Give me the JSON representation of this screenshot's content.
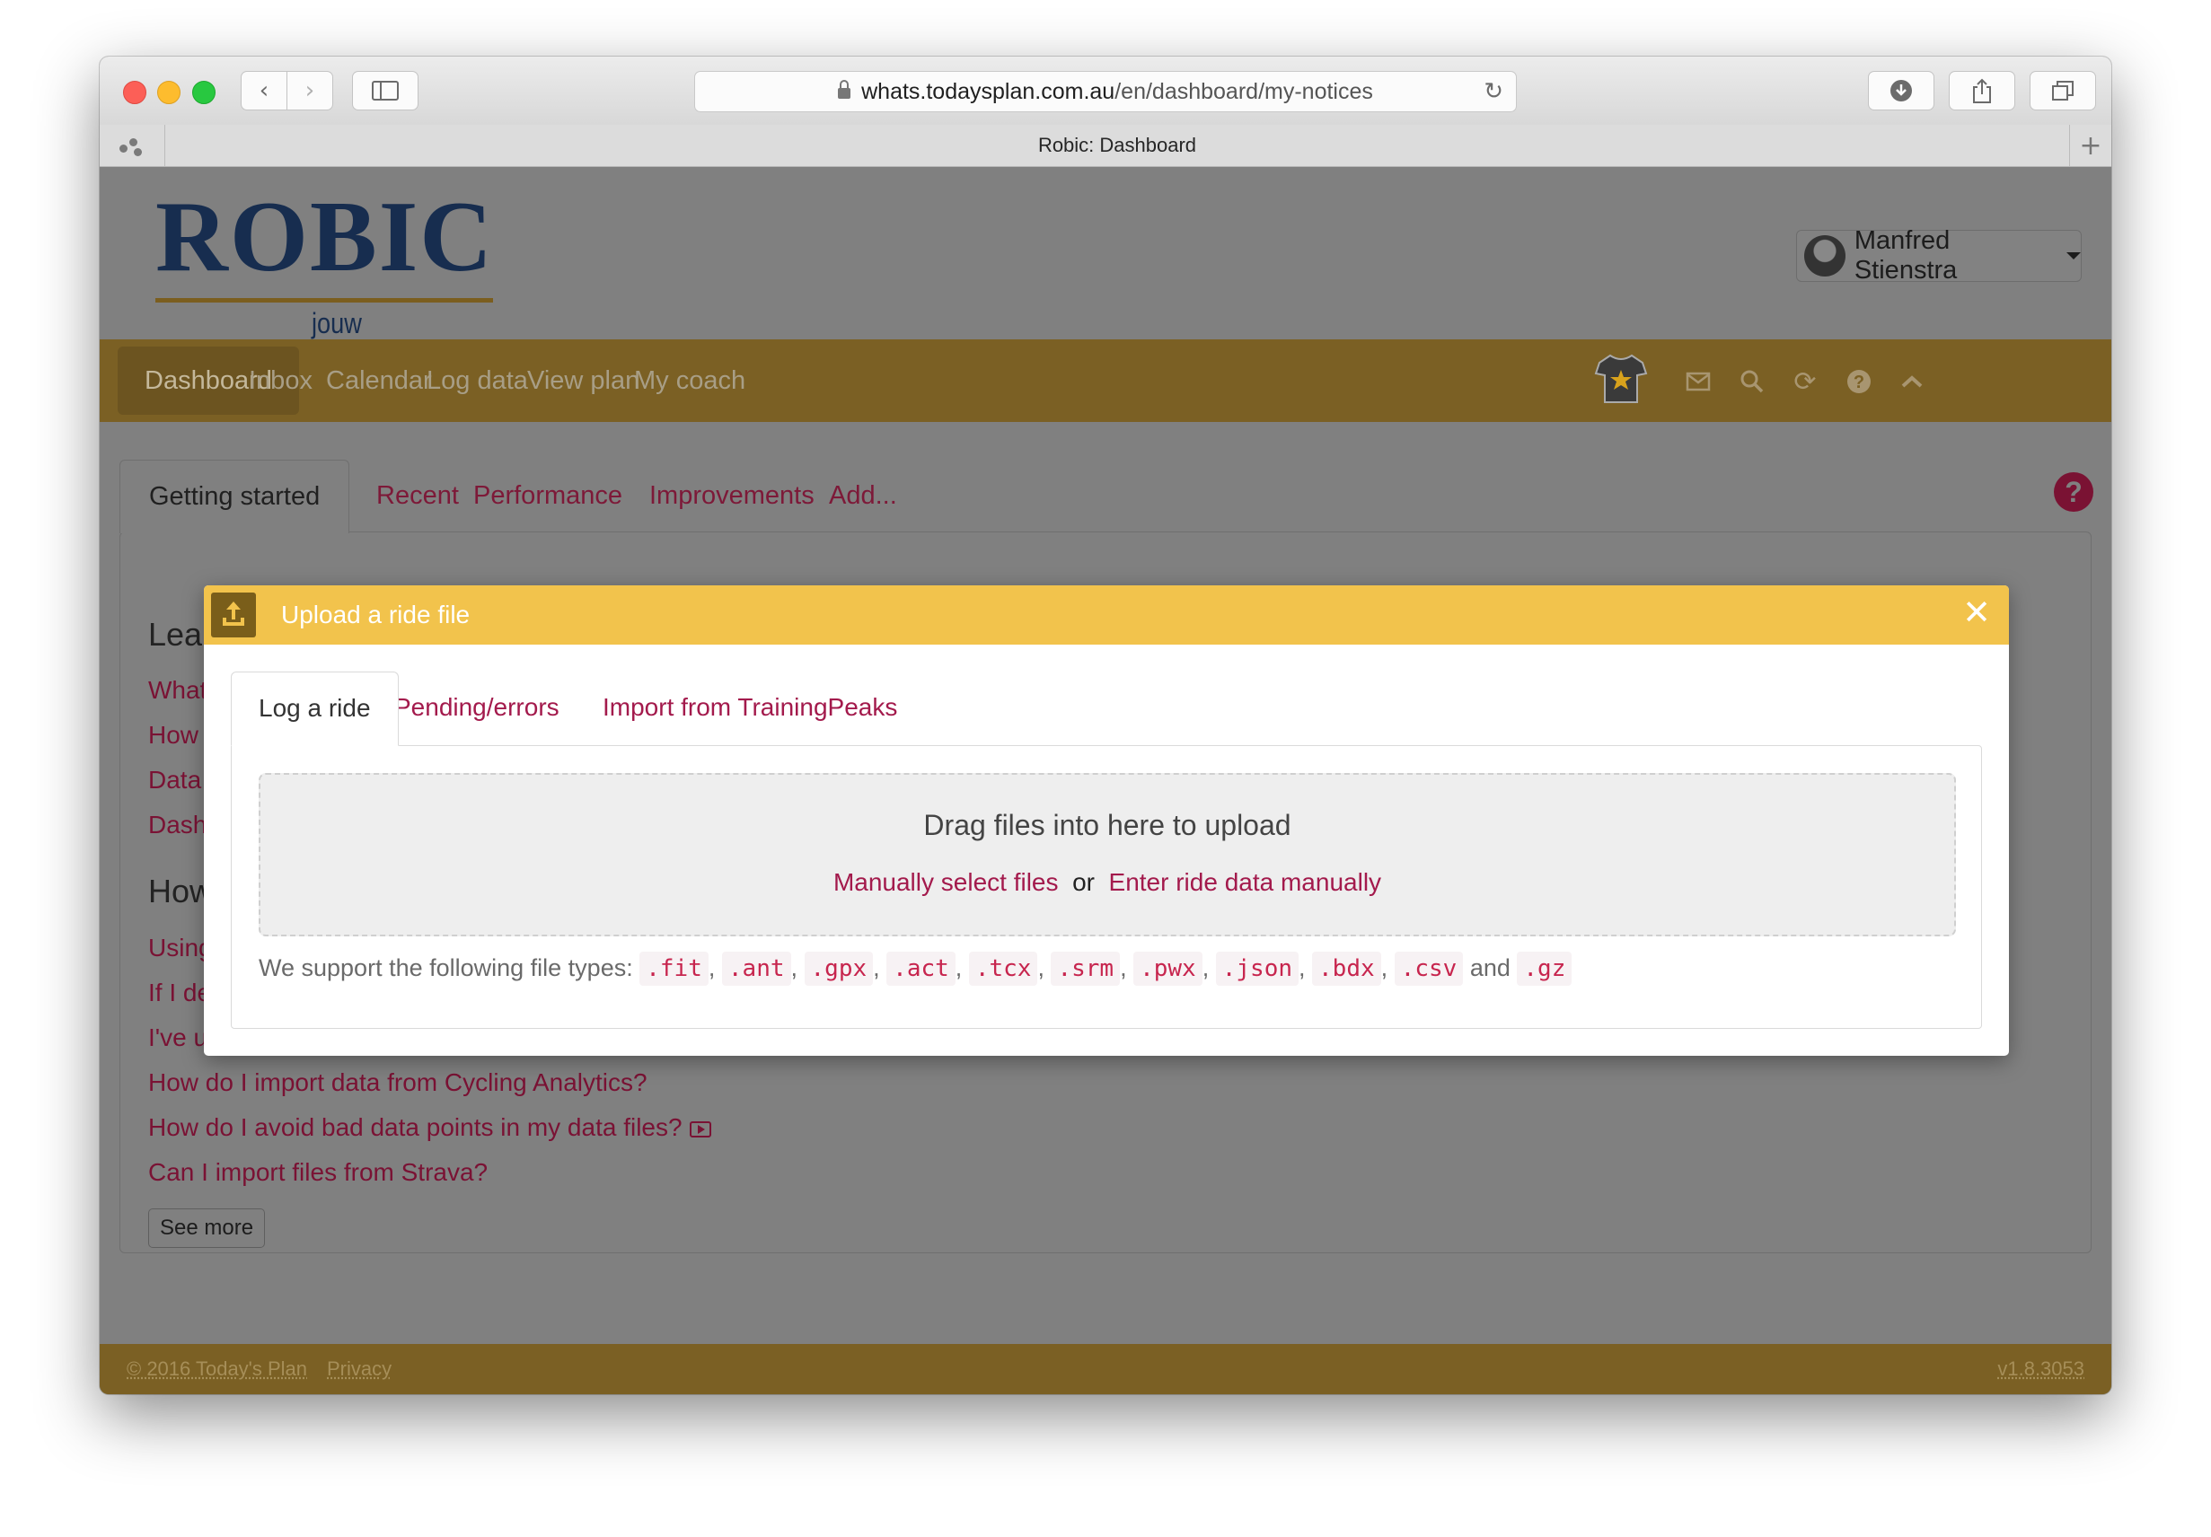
{
  "browser": {
    "url_host": "whats.todaysplan.com.au",
    "url_path": "/en/dashboard/my-notices",
    "tab_title": "Robic: Dashboard"
  },
  "header": {
    "logo_text": "ROBIC",
    "logo_tagline": "jouw wielercoach.",
    "user_name": "Manfred Stienstra"
  },
  "nav": {
    "items": [
      "Dashboard",
      "Inbox",
      "Calendar",
      "Log data",
      "View plan",
      "My coach"
    ],
    "active": "Dashboard",
    "icons": [
      "jersey-star-icon",
      "mail-icon",
      "search-icon",
      "sync-icon",
      "help-icon",
      "collapse-icon"
    ]
  },
  "page_tabs": {
    "items": [
      "Getting started",
      "Recent",
      "Performance",
      "Improvements",
      "Add..."
    ],
    "help": "?"
  },
  "getting_started": {
    "heading1": "Lea",
    "links1": [
      "What",
      "How",
      "Data",
      "Dash"
    ],
    "heading2": "How",
    "links2_partial": [
      "Using",
      "If I de",
      "I've u"
    ],
    "links2_full": [
      "How do I import data from Cycling Analytics?",
      "How do I avoid bad data points in my data files?",
      "Can I import files from Strava?"
    ],
    "see_more": "See more"
  },
  "footer": {
    "copyright": "© 2016 Today's Plan",
    "privacy": "Privacy",
    "version": "v1.8.3053"
  },
  "modal": {
    "title": "Upload a ride file",
    "close": "✕",
    "tabs": [
      "Log a ride",
      "Pending/errors",
      "Import from TrainingPeaks"
    ],
    "drop_title": "Drag files into here to upload",
    "manual_select": "Manually select files",
    "or": "or",
    "enter_manual": "Enter ride data manually",
    "support_text": "We support the following file types:",
    "file_types": [
      ".fit",
      ".ant",
      ".gpx",
      ".act",
      ".tcx",
      ".srm",
      ".pwx",
      ".json",
      ".bdx",
      ".csv"
    ],
    "and": "and",
    "last_type": ".gz"
  },
  "colors": {
    "modal_header": "#f2c34c",
    "link": "#a31a4c",
    "nav_bg": "#7b6024",
    "brand_navy": "#172d4f"
  }
}
